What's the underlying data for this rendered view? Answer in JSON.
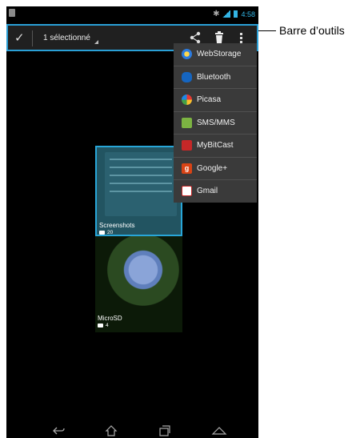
{
  "status_bar": {
    "time": "4:58"
  },
  "action_bar": {
    "selection_label": "1 sélectionné",
    "icons": [
      "check-icon",
      "share-icon",
      "trash-icon",
      "overflow-menu-icon"
    ]
  },
  "callout": {
    "label": "Barre d’outils"
  },
  "share_menu": {
    "items": [
      {
        "label": "WebStorage",
        "icon": "webstorage-icon"
      },
      {
        "label": "Bluetooth",
        "icon": "bluetooth-icon"
      },
      {
        "label": "Picasa",
        "icon": "picasa-icon"
      },
      {
        "label": "SMS/MMS",
        "icon": "sms-icon"
      },
      {
        "label": "MyBitCast",
        "icon": "mybitcast-icon"
      },
      {
        "label": "Google+",
        "icon": "googleplus-icon"
      },
      {
        "label": "Gmail",
        "icon": "gmail-icon"
      }
    ]
  },
  "albums": [
    {
      "name": "Screenshots",
      "count": "20"
    },
    {
      "name": "MicroSD",
      "count": "4"
    }
  ],
  "colors": {
    "accent": "#2a9fd6",
    "menu_bg": "#3a3a3a",
    "background": "#000000"
  }
}
